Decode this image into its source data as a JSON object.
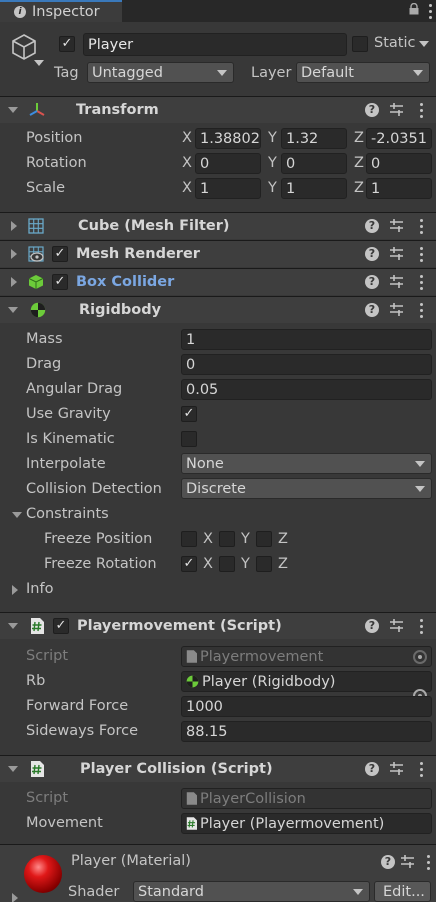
{
  "tab": {
    "title": "Inspector"
  },
  "object": {
    "name": "Player",
    "static_label": "Static",
    "tag_label": "Tag",
    "tag_value": "Untagged",
    "layer_label": "Layer",
    "layer_value": "Default"
  },
  "transform": {
    "title": "Transform",
    "position_label": "Position",
    "rotation_label": "Rotation",
    "scale_label": "Scale",
    "axis_x": "X",
    "axis_y": "Y",
    "axis_z": "Z",
    "position": {
      "x": "1.38802",
      "y": "1.32",
      "z": "-2.0351"
    },
    "rotation": {
      "x": "0",
      "y": "0",
      "z": "0"
    },
    "scale": {
      "x": "1",
      "y": "1",
      "z": "1"
    }
  },
  "components": {
    "mesh_filter": "Cube (Mesh Filter)",
    "mesh_renderer": "Mesh Renderer",
    "box_collider": "Box Collider"
  },
  "rigidbody": {
    "title": "Rigidbody",
    "mass_label": "Mass",
    "mass": "1",
    "drag_label": "Drag",
    "drag": "0",
    "angular_drag_label": "Angular Drag",
    "angular_drag": "0.05",
    "use_gravity_label": "Use Gravity",
    "use_gravity_check": "✓",
    "is_kinematic_label": "Is Kinematic",
    "interpolate_label": "Interpolate",
    "interpolate": "None",
    "collision_label": "Collision Detection",
    "collision": "Discrete",
    "constraints_label": "Constraints",
    "freeze_position_label": "Freeze Position",
    "freeze_rotation_label": "Freeze Rotation",
    "freeze_rotation_x_check": "✓",
    "info_label": "Info"
  },
  "playermovement": {
    "title": "Playermovement (Script)",
    "script_label": "Script",
    "script_value": "Playermovement",
    "rb_label": "Rb",
    "rb_value": "Player  (Rigidbody)",
    "forward_label": "Forward Force",
    "forward_value": "1000",
    "sideways_label": "Sideways Force",
    "sideways_value": "88.15"
  },
  "playercollision": {
    "title": "Player Collision (Script)",
    "script_label": "Script",
    "script_value": "PlayerCollision",
    "movement_label": "Movement",
    "movement_value": "Player  (Playermovement)"
  },
  "material": {
    "title": "Player (Material)",
    "shader_label": "Shader",
    "shader_value": "Standard",
    "edit_label": "Edit..."
  },
  "colors": {
    "accent_blue": "#3a79bb",
    "panel": "#383838",
    "header": "#3e3e3e",
    "field": "#2a2a2a",
    "link_blue": "#7ba7e2"
  },
  "icons": [
    "info-icon",
    "lock-icon",
    "kebab-icon",
    "cube-icon",
    "transform-gizmo-icon",
    "help-icon",
    "preset-icon",
    "mesh-filter-grid-icon",
    "mesh-renderer-icon",
    "box-collider-icon",
    "rigidbody-icon",
    "script-icon",
    "object-picker-icon",
    "material-sphere-icon"
  ]
}
